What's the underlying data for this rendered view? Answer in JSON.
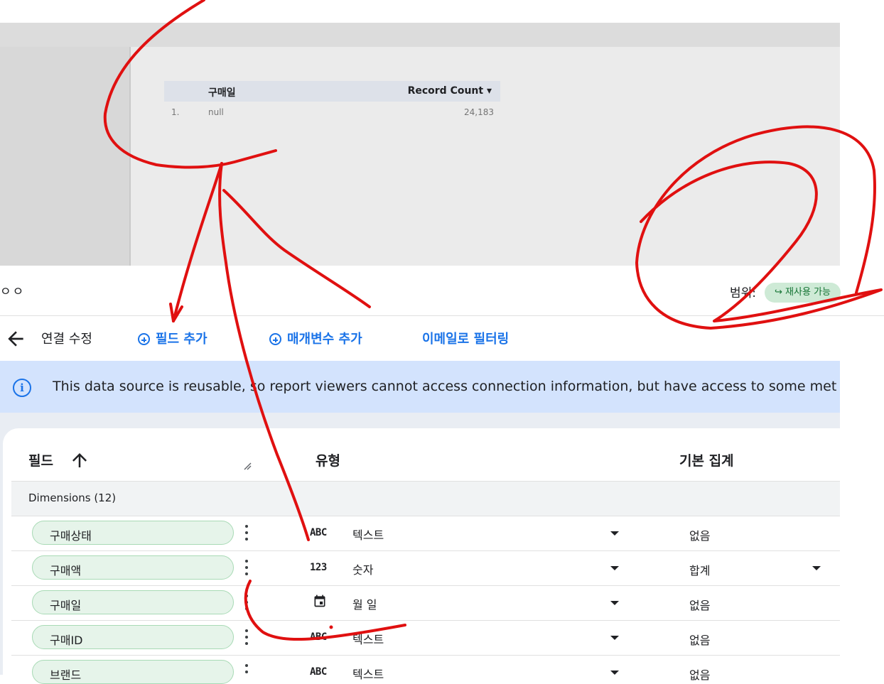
{
  "report": {
    "table": {
      "headers": [
        "구매일",
        "Record Count ▾"
      ],
      "rows": [
        {
          "index": "1.",
          "date": "null",
          "count": "24,183"
        }
      ]
    }
  },
  "editor": {
    "title": "ㅇㅇ",
    "scope_label": "범위:",
    "scope_chip": "↪ 재사용 가능",
    "toolbar": {
      "back_icon": "arrow-left-icon",
      "edit_connection": "연결 수정",
      "add_field": "필드 추가",
      "add_parameter": "매개변수 추가",
      "email_filter": "이메일로 필터링"
    },
    "banner": {
      "text": "This data source is reusable, so report viewers cannot access connection information, but have access to some met"
    },
    "columns": {
      "field": "필드",
      "type": "유형",
      "aggregation": "기본 집계"
    },
    "group_label": "Dimensions (12)",
    "fields": [
      {
        "name": "구매상태",
        "type_icon": "ABC",
        "type": "텍스트",
        "agg": "없음"
      },
      {
        "name": "구매액",
        "type_icon": "123",
        "type": "숫자",
        "agg": "합계"
      },
      {
        "name": "구매일",
        "type_icon": "calendar-icon",
        "type": "월 일",
        "agg": "없음"
      },
      {
        "name": "구매ID",
        "type_icon": "ABC",
        "type": "텍스트",
        "agg": "없음"
      },
      {
        "name": "브랜드",
        "type_icon": "ABC",
        "type": "텍스트",
        "agg": "없음"
      }
    ],
    "colors": {
      "accent": "#1a73e8",
      "banner_bg": "#d3e3fd",
      "pill_bg": "#e6f4ea",
      "scope_chip_bg": "#ceead6",
      "annotation": "#e01010"
    }
  }
}
